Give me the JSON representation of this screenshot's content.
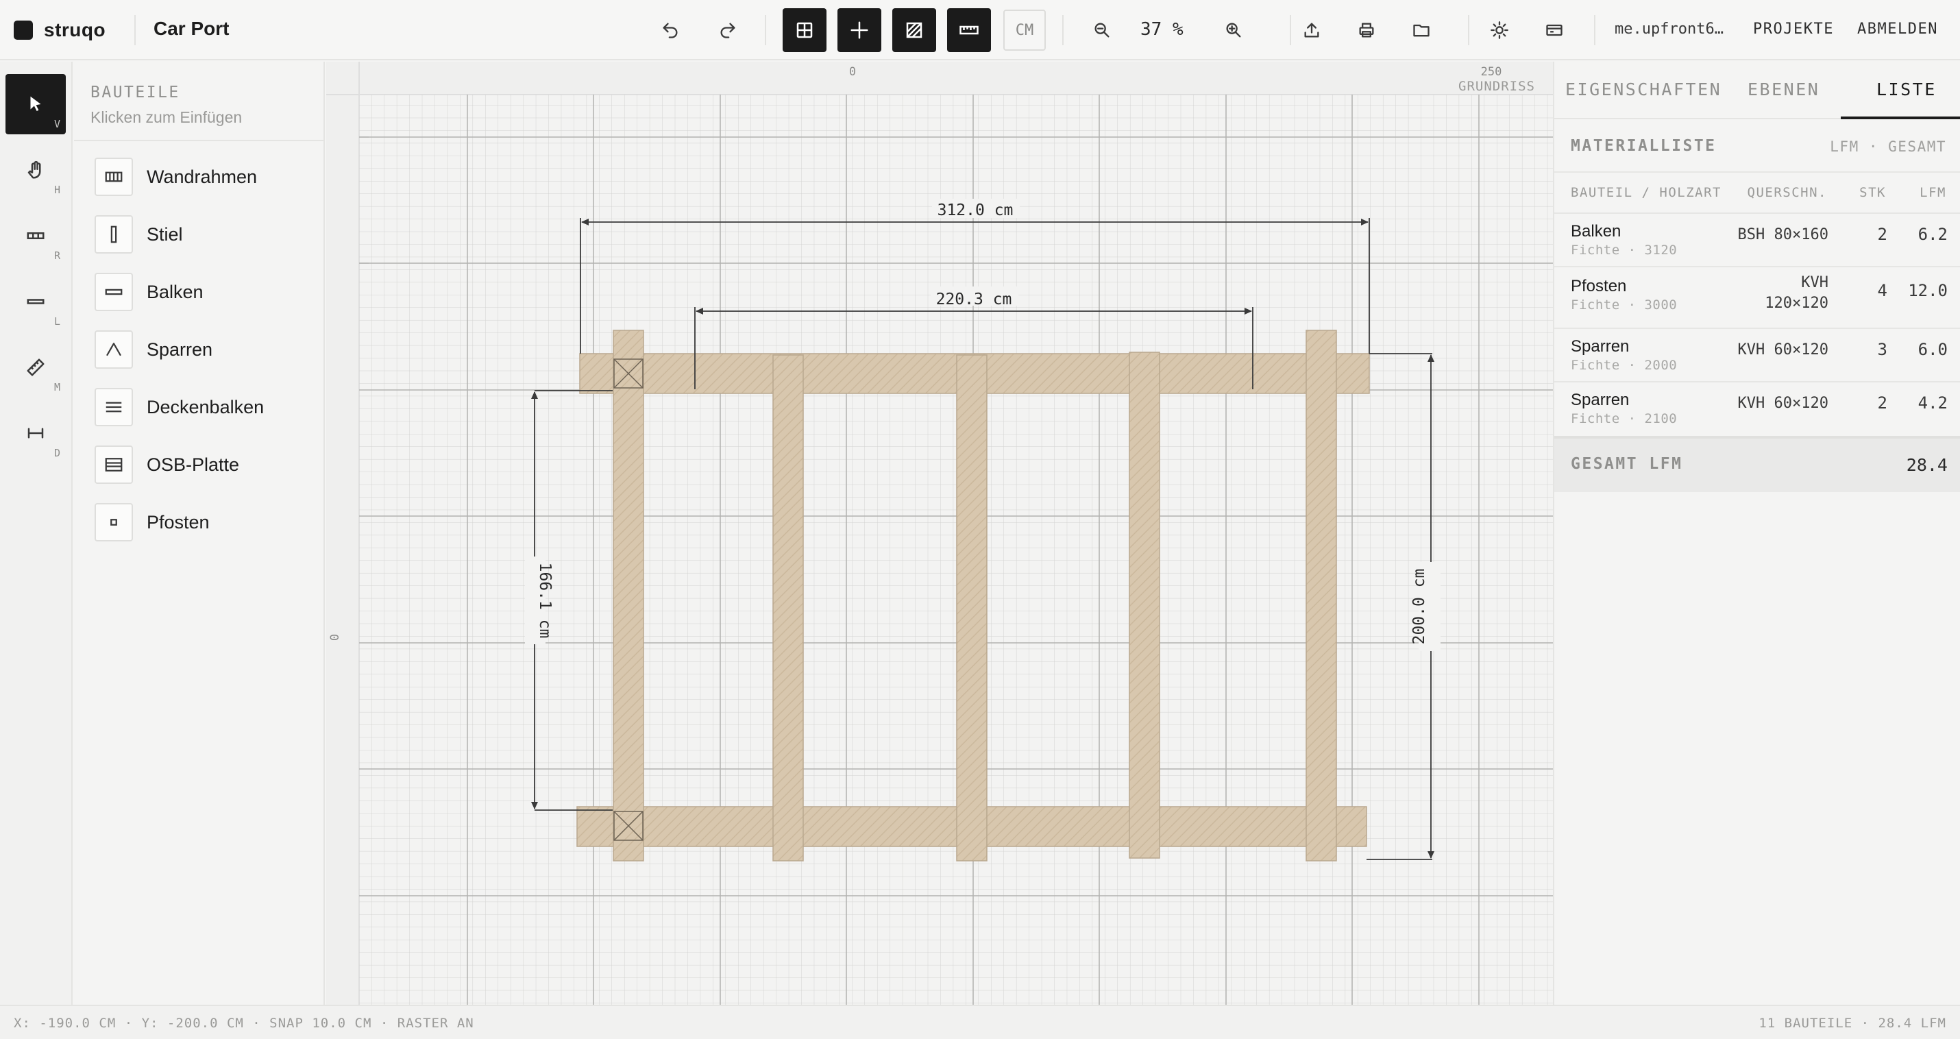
{
  "app": {
    "brand": "struqo",
    "project": "Car Port"
  },
  "toolbar": {
    "unit": "CM",
    "zoom": "37 %",
    "user": "me.upfront6…",
    "projects": "PROJEKTE",
    "logout": "ABMELDEN"
  },
  "tools": [
    {
      "key": "V",
      "icon": "cursor-icon"
    },
    {
      "key": "H",
      "icon": "hand-icon"
    },
    {
      "key": "R",
      "icon": "frame-icon"
    },
    {
      "key": "L",
      "icon": "line-icon"
    },
    {
      "key": "M",
      "icon": "ruler-icon"
    },
    {
      "key": "D",
      "icon": "dimension-icon"
    }
  ],
  "parts": {
    "title": "BAUTEILE",
    "subtitle": "Klicken zum Einfügen",
    "items": [
      {
        "label": "Wandrahmen",
        "icon": "wall-frame-icon"
      },
      {
        "label": "Stiel",
        "icon": "stud-icon"
      },
      {
        "label": "Balken",
        "icon": "beam-icon"
      },
      {
        "label": "Sparren",
        "icon": "rafter-icon"
      },
      {
        "label": "Deckenbalken",
        "icon": "joist-icon"
      },
      {
        "label": "OSB-Platte",
        "icon": "osb-panel-icon"
      },
      {
        "label": "Pfosten",
        "icon": "post-icon"
      }
    ]
  },
  "canvas": {
    "ruler_top": [
      "0",
      "250"
    ],
    "ruler_left": [
      "0"
    ],
    "view_label": "GRUNDRISS",
    "dimensions": {
      "width_outer": "312.0 cm",
      "width_inner": "220.3 cm",
      "height_left": "166.1 cm",
      "height_right": "200.0 cm"
    }
  },
  "right_panel": {
    "tabs": [
      "EIGENSCHAFTEN",
      "EBENEN",
      "LISTE"
    ],
    "active_tab": "LISTE",
    "material_title": "MATERIALLISTE",
    "material_sub": "LFM · GESAMT",
    "headers": {
      "part": "BAUTEIL / HOLZART",
      "section": "QUERSCHN.",
      "qty": "STK",
      "lfm": "LFM"
    },
    "rows": [
      {
        "name": "Balken",
        "wood": "Fichte · 3120",
        "section": "BSH 80×160",
        "section2": "",
        "qty": "2",
        "lfm": "6.2"
      },
      {
        "name": "Pfosten",
        "wood": "Fichte · 3000",
        "section": "KVH",
        "section2": "120×120",
        "qty": "4",
        "lfm": "12.0"
      },
      {
        "name": "Sparren",
        "wood": "Fichte · 2000",
        "section": "KVH 60×120",
        "section2": "",
        "qty": "3",
        "lfm": "6.0"
      },
      {
        "name": "Sparren",
        "wood": "Fichte · 2100",
        "section": "KVH 60×120",
        "section2": "",
        "qty": "2",
        "lfm": "4.2"
      }
    ],
    "total_label": "GESAMT LFM",
    "total_value": "28.4"
  },
  "status": {
    "left": "X: -190.0 CM · Y: -200.0 CM · SNAP 10.0 CM · RASTER AN",
    "right": "11 BAUTEILE · 28.4 LFM"
  }
}
